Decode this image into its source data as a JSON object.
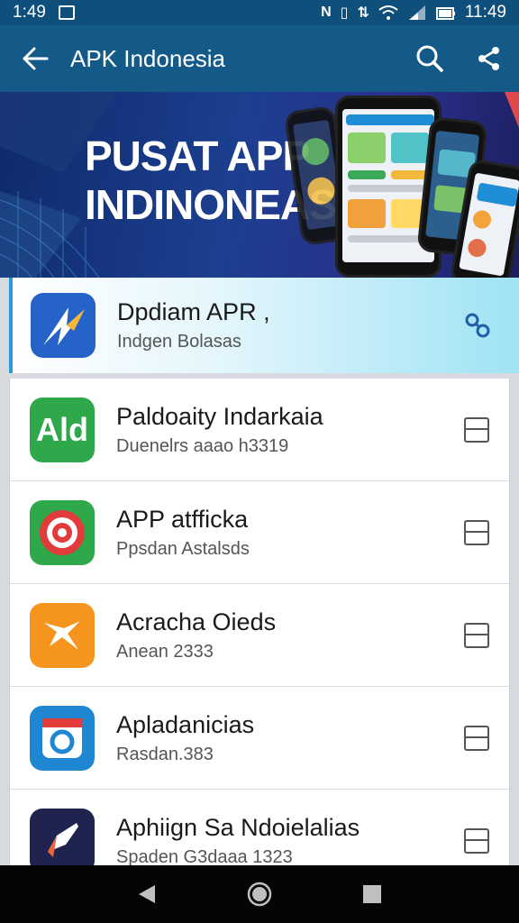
{
  "status_bar": {
    "time_left": "1:49",
    "time_right": "11:49"
  },
  "app_bar": {
    "title": "APK Indonesia"
  },
  "banner": {
    "title": "PUSAT APP\nINDINONEASIA"
  },
  "featured": {
    "title": "Dpdiam APR ,",
    "subtitle": "Indgen Bolasas"
  },
  "apps": [
    {
      "title": "Paldoaity Indarkaia",
      "subtitle": "Duenelrs aaao h3319",
      "icon": "ald-icon",
      "icon_text": "Ald"
    },
    {
      "title": "APP atfficka",
      "subtitle": "Ppsdan Astalsds",
      "icon": "target-icon"
    },
    {
      "title": "Acracha Oieds",
      "subtitle": "Anean 2333",
      "icon": "wrench-icon"
    },
    {
      "title": "Apladanicias",
      "subtitle": "Rasdan.383",
      "icon": "camera-icon"
    },
    {
      "title": "Aphiign Sa Ndoielalias",
      "subtitle": "Spaden G3daaa 1323",
      "icon": "rocket-icon"
    }
  ],
  "colors": {
    "status_bar": "#0f4f7c",
    "app_bar": "#135a89",
    "accent": "#2a9bd6"
  }
}
